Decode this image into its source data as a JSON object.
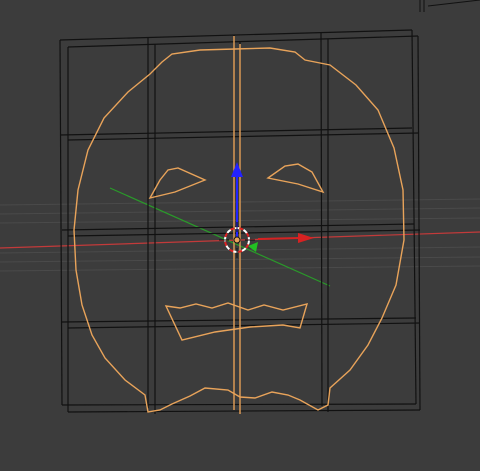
{
  "viewport": {
    "mode": "edit",
    "object_type": "mesh",
    "outline_color": "#e8a35a",
    "wire_color": "#111111",
    "background_color": "#3c3c3c"
  },
  "axes": {
    "x_axis_color": "#c33a3a",
    "y_axis_color": "#2a9a2a",
    "z_axis_color": "#2323d8"
  },
  "gizmo": {
    "type": "translate",
    "x_handle_color": "#d62222",
    "y_handle_color": "#22c022",
    "z_handle_color": "#2222ff"
  },
  "icons": {
    "cursor": "3d-cursor-icon",
    "origin": "object-origin-icon"
  }
}
